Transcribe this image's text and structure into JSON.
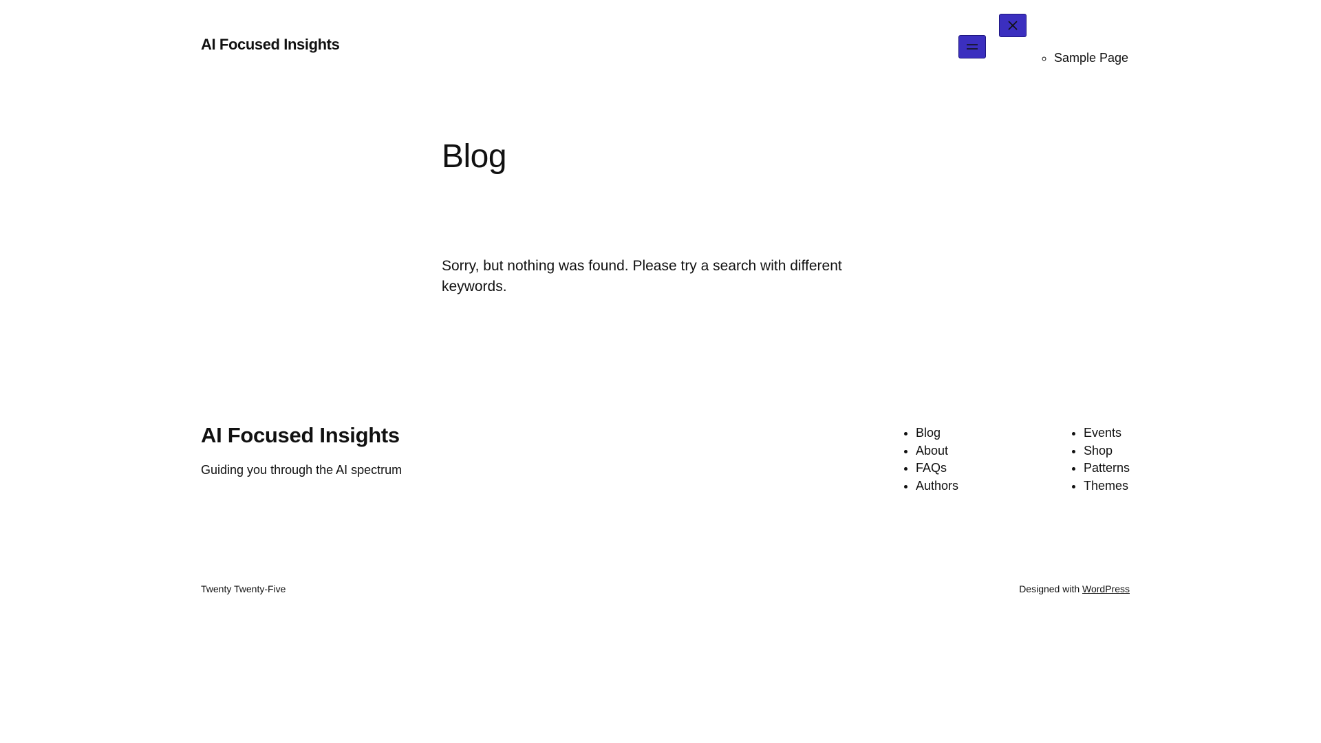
{
  "header": {
    "site_title": "AI Focused Insights",
    "open_menu_icon": "hamburger-icon",
    "close_menu_icon": "close-icon",
    "nav_items": [
      "Sample Page"
    ]
  },
  "main": {
    "heading": "Blog",
    "message": "Sorry, but nothing was found. Please try a search with different keywords."
  },
  "footer": {
    "site_title": "AI Focused Insights",
    "tagline": "Guiding you through the AI spectrum",
    "nav_col_1": [
      "Blog",
      "About",
      "FAQs",
      "Authors"
    ],
    "nav_col_2": [
      "Events",
      "Shop",
      "Patterns",
      "Themes"
    ],
    "credit_left": "Twenty Twenty-Five",
    "credit_prefix": "Designed with",
    "credit_link": "WordPress"
  },
  "colors": {
    "button_bg": "#3b2fbf",
    "text": "#111111",
    "background": "#ffffff"
  }
}
